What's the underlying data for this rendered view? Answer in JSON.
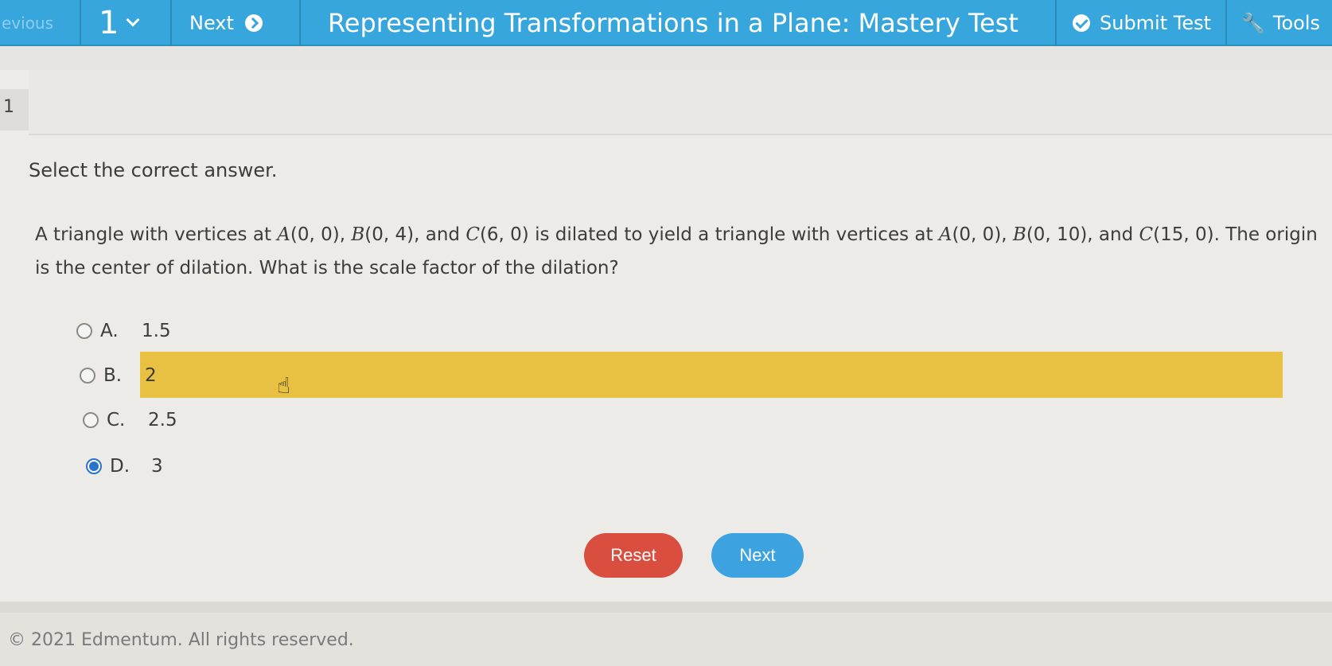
{
  "toolbar": {
    "previous_label": "evious",
    "question_number": "1",
    "next_label": "Next",
    "title": "Representing Transformations in a Plane: Mastery Test",
    "submit_label": "Submit Test",
    "tools_label": "Tools"
  },
  "question": {
    "number": "1",
    "instruction": "Select the correct answer.",
    "text_parts": {
      "p1": "A triangle with vertices at ",
      "A": "A",
      "a_coord": "(0, 0), ",
      "B": "B",
      "b_coord": "(0, 4), and ",
      "C": "C",
      "c_coord": "(6, 0) is dilated to yield a triangle with vertices at ",
      "A2": "A",
      "a2_coord": "(0, 0), ",
      "B2": "B",
      "b2_coord": "(0, 10), and ",
      "C2": "C",
      "c2_coord": "(15, 0). The origin is the center of dilation. What is the scale factor of the dilation?"
    },
    "choices": [
      {
        "letter": "A.",
        "value": "1.5"
      },
      {
        "letter": "B.",
        "value": "2"
      },
      {
        "letter": "C.",
        "value": "2.5"
      },
      {
        "letter": "D.",
        "value": "3"
      }
    ],
    "selected": "D"
  },
  "actions": {
    "reset_label": "Reset",
    "next_label": "Next"
  },
  "footer": {
    "copyright": "© 2021 Edmentum. All rights reserved."
  },
  "colors": {
    "toolbar": "#36a6dc",
    "highlight": "#e8c142",
    "reset": "#d94e3f",
    "next": "#3ca3e0",
    "radio_selected": "#2a74c8"
  }
}
